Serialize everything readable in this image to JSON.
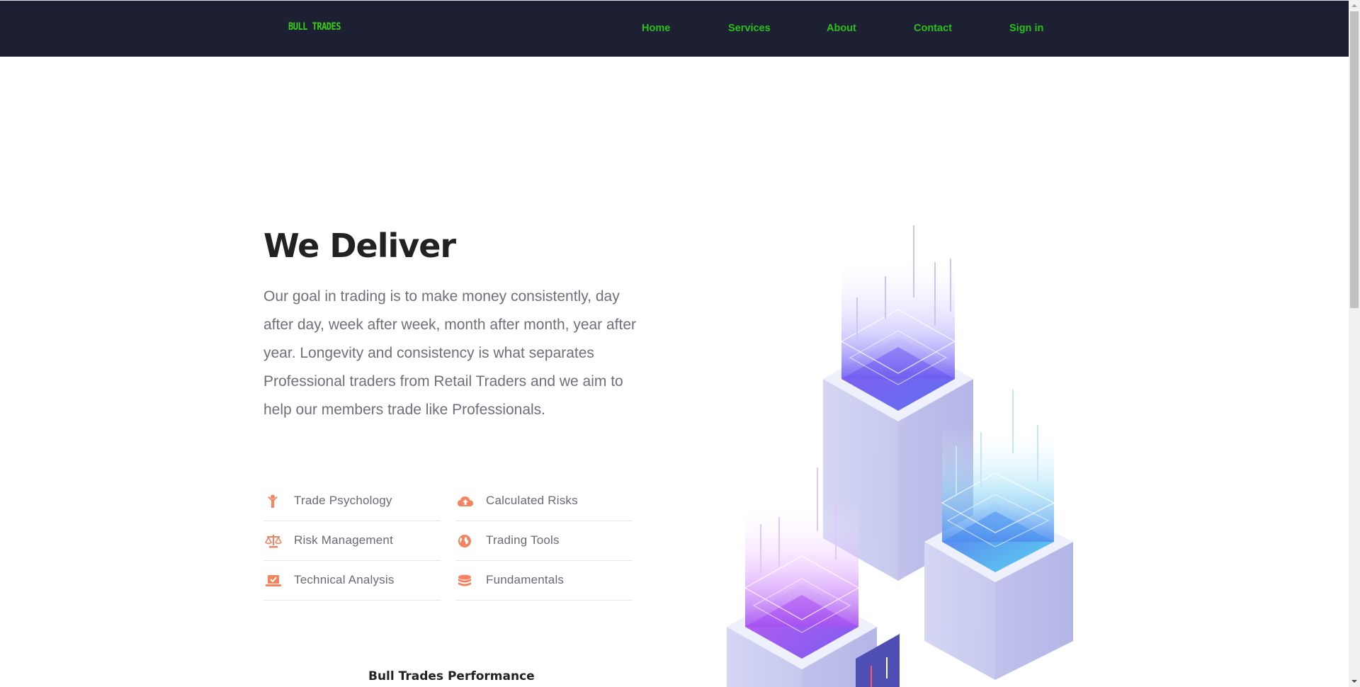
{
  "brand": {
    "name": "BULL TRADES",
    "color": "#39d01a"
  },
  "nav": {
    "items": [
      {
        "label": "Home"
      },
      {
        "label": "Services"
      },
      {
        "label": "About"
      },
      {
        "label": "Contact"
      },
      {
        "label": "Sign in"
      }
    ]
  },
  "hero": {
    "title": "We Deliver",
    "text": "Our goal in trading is to make money consistently, day after day, week after week, month after month, year after year. Longevity and consistency is what separates Professional traders from Retail Traders and we aim to help our members trade like Professionals."
  },
  "features": {
    "left": [
      {
        "label": "Trade Psychology",
        "icon": "person-icon"
      },
      {
        "label": "Risk Management",
        "icon": "scale-icon"
      },
      {
        "label": "Technical Analysis",
        "icon": "laptop-check-icon"
      }
    ],
    "right": [
      {
        "label": "Calculated Risks",
        "icon": "cloud-upload-icon"
      },
      {
        "label": "Trading Tools",
        "icon": "globe-icon"
      },
      {
        "label": "Fundamentals",
        "icon": "database-icon"
      }
    ]
  },
  "performance": {
    "title": "Bull Trades Performance"
  },
  "colors": {
    "navbar": "#1d2033",
    "nav_link": "#2bbf1b",
    "accent_icon": "#f4845f",
    "heading": "#222222",
    "body_text": "#6f6f7a"
  }
}
